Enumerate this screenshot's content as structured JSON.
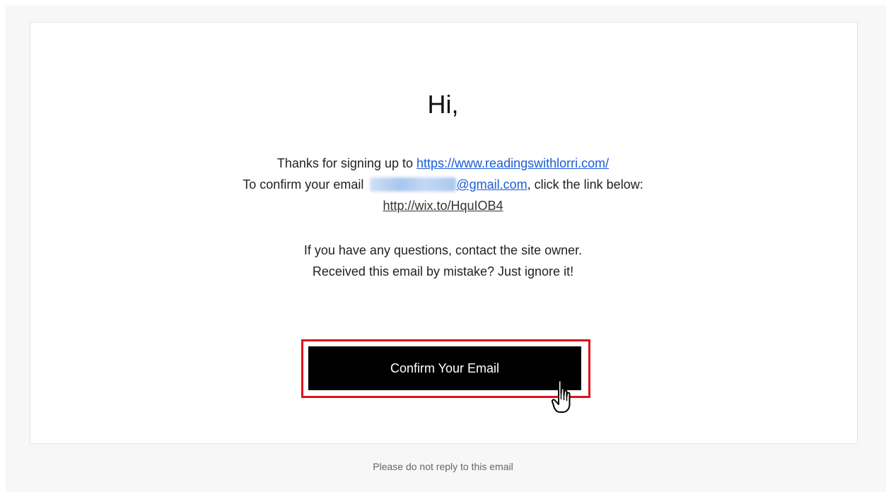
{
  "email": {
    "greeting": "Hi,",
    "signup_prefix": "Thanks for signing up to ",
    "site_link": "https://www.readingswithlorri.com/",
    "confirm_prefix": "To confirm your email ",
    "email_domain": "@gmail.com",
    "confirm_suffix": ", click the link below:",
    "confirm_link": "http://wix.to/HquIOB4",
    "questions_line": "If you have any questions, contact the site owner.",
    "mistake_line": "Received this email by mistake? Just ignore it!",
    "button_label": "Confirm Your Email",
    "footer_note": "Please do not reply to this email"
  },
  "colors": {
    "link_blue": "#1a5cd6",
    "button_bg": "#000000",
    "highlight_red": "#e0101b",
    "page_bg": "#f7f7f7"
  },
  "icons": {
    "cursor": "hand-pointer-icon",
    "redacted": "blurred-email-username"
  }
}
